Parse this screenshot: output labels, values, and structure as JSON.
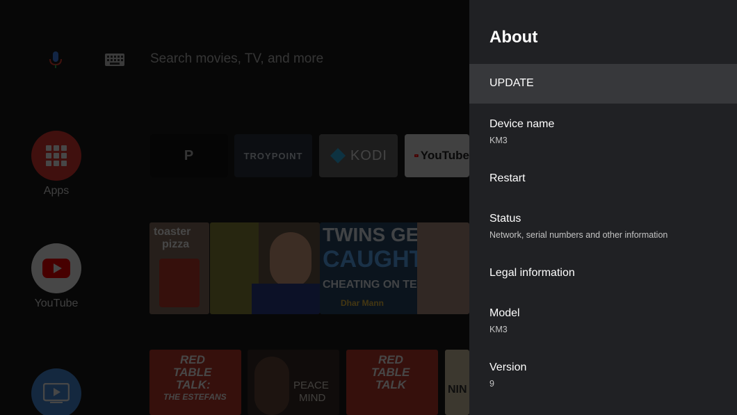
{
  "launcher": {
    "search_placeholder": "Search movies, TV, and more",
    "side_apps": [
      {
        "label": "Apps",
        "icon": "apps-grid-icon",
        "color": "#e53935"
      },
      {
        "label": "YouTube",
        "icon": "youtube-play-icon",
        "color": "#ffffff"
      },
      {
        "label": "",
        "icon": "play-tv-icon",
        "color": "#4a90e2"
      }
    ],
    "favorites": [
      {
        "label": "P"
      },
      {
        "label": "TROYPOINT"
      },
      {
        "label": "KODI"
      },
      {
        "label": "YouTube"
      }
    ],
    "thumbnails_row1": [
      {
        "text_a": "toaster",
        "text_b": "pizza"
      },
      {
        "text_a": "TWINS GET",
        "text_b": "CAUGHT",
        "text_c": "CHEATING ON TEST",
        "text_d": "Dhar Mann"
      }
    ],
    "thumbnails_row2": [
      {
        "text_a": "RED",
        "text_b": "TABLE",
        "text_c": "TALK:",
        "text_d": "THE ESTEFANS"
      },
      {
        "text_a": "PEACE",
        "text_b": "MIND"
      },
      {
        "text_a": "RED",
        "text_b": "TABLE",
        "text_c": "TALK"
      },
      {
        "text_a": "NIN"
      }
    ]
  },
  "about": {
    "title": "About",
    "items": [
      {
        "title": "UPDATE",
        "subtitle": ""
      },
      {
        "title": "Device name",
        "subtitle": "KM3"
      },
      {
        "title": "Restart",
        "subtitle": ""
      },
      {
        "title": "Status",
        "subtitle": "Network, serial numbers and other information"
      },
      {
        "title": "Legal information",
        "subtitle": ""
      },
      {
        "title": "Model",
        "subtitle": "KM3"
      },
      {
        "title": "Version",
        "subtitle": "9"
      }
    ]
  },
  "colors": {
    "panel_bg": "#202124",
    "selected_bg": "#37383b",
    "apps_red": "#e53935",
    "youtube_red": "#ff0000"
  }
}
